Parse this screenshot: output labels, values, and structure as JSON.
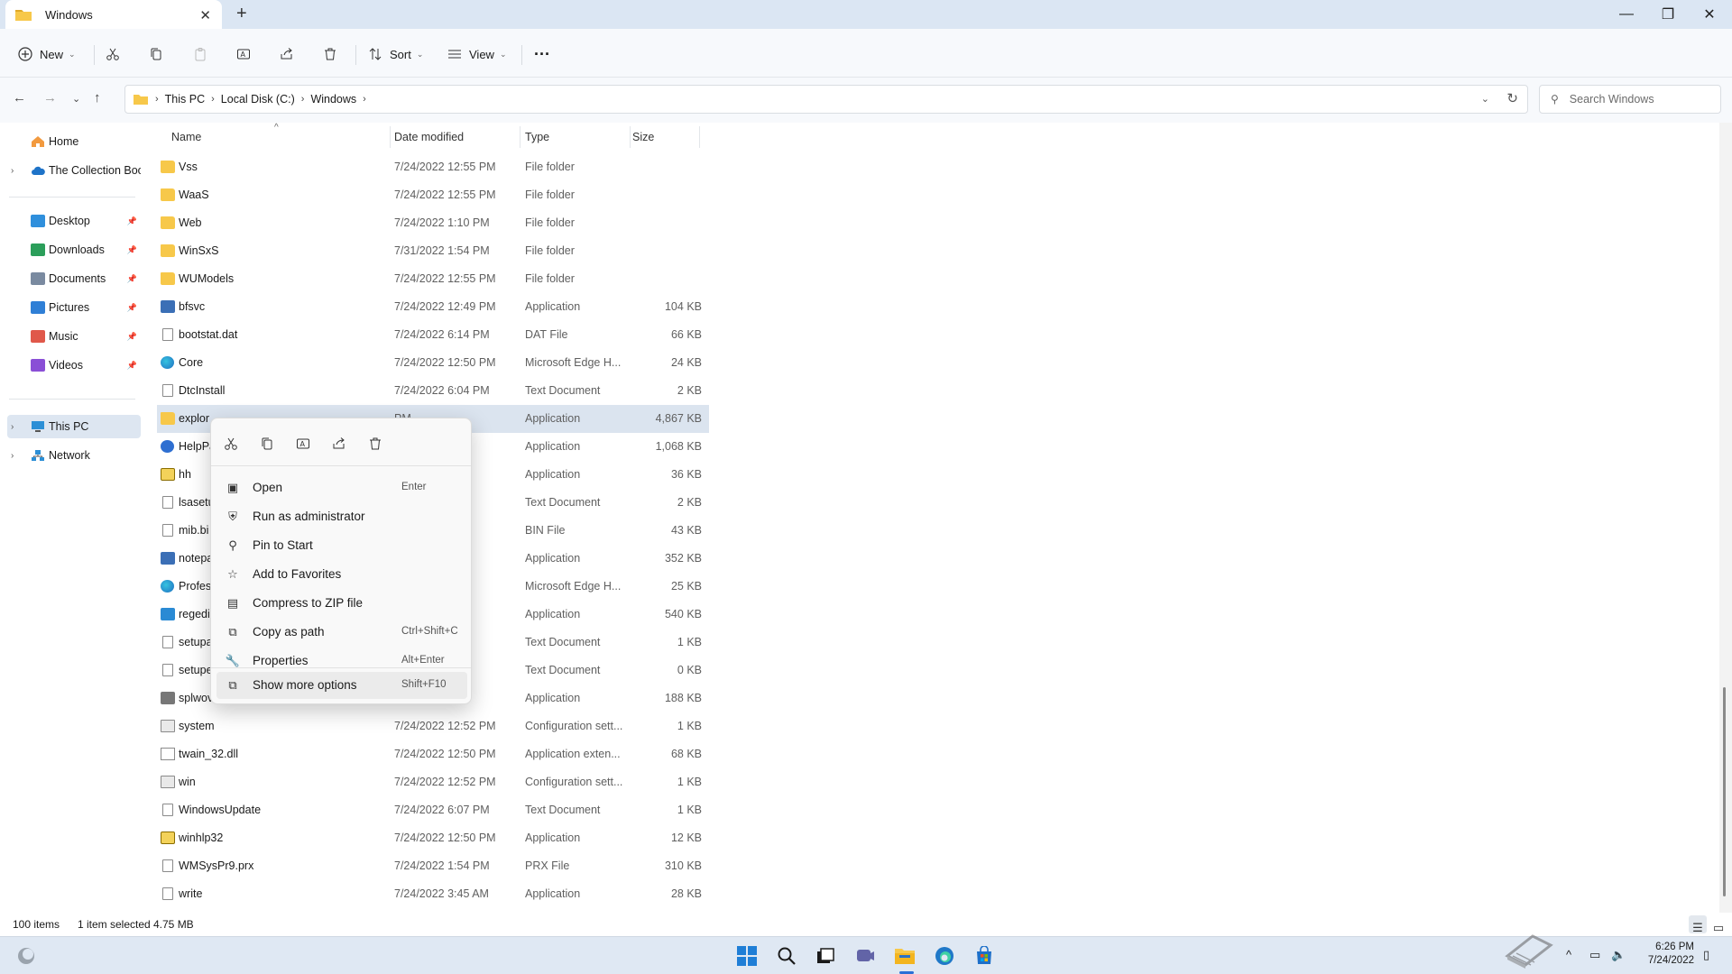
{
  "window": {
    "tab_title": "Windows",
    "new_tab": "+",
    "close_tab": "✕",
    "minimize": "—",
    "maximize": "❐",
    "close": "✕"
  },
  "toolbar": {
    "new_label": "New",
    "sort_label": "Sort",
    "view_label": "View",
    "more": "···",
    "icons": [
      "cut-icon",
      "copy-icon",
      "paste-icon",
      "rename-icon",
      "share-icon",
      "delete-icon"
    ]
  },
  "address": {
    "crumbs": [
      "This PC",
      "Local Disk (C:)",
      "Windows"
    ],
    "search_placeholder": "Search Windows"
  },
  "nav": {
    "top": [
      {
        "label": "Home"
      },
      {
        "label": "The Collection Boo"
      }
    ],
    "quick": [
      {
        "label": "Desktop",
        "color": "#2f8fdc"
      },
      {
        "label": "Downloads",
        "color": "#2b9e5a"
      },
      {
        "label": "Documents",
        "color": "#7a8aa0"
      },
      {
        "label": "Pictures",
        "color": "#2f7fd6"
      },
      {
        "label": "Music",
        "color": "#e0584a"
      },
      {
        "label": "Videos",
        "color": "#8a4fd6"
      }
    ],
    "devices": [
      {
        "label": "This PC"
      },
      {
        "label": "Network"
      }
    ]
  },
  "columns": {
    "name": "Name",
    "date": "Date modified",
    "type": "Type",
    "size": "Size"
  },
  "files": [
    {
      "name": "Vss",
      "date": "7/24/2022 12:55 PM",
      "type": "File folder",
      "size": "",
      "icon": "folder"
    },
    {
      "name": "WaaS",
      "date": "7/24/2022 12:55 PM",
      "type": "File folder",
      "size": "",
      "icon": "folder"
    },
    {
      "name": "Web",
      "date": "7/24/2022 1:10 PM",
      "type": "File folder",
      "size": "",
      "icon": "folder"
    },
    {
      "name": "WinSxS",
      "date": "7/31/2022 1:54 PM",
      "type": "File folder",
      "size": "",
      "icon": "folder"
    },
    {
      "name": "WUModels",
      "date": "7/24/2022 12:55 PM",
      "type": "File folder",
      "size": "",
      "icon": "folder"
    },
    {
      "name": "bfsvc",
      "date": "7/24/2022 12:49 PM",
      "type": "Application",
      "size": "104 KB",
      "icon": "app"
    },
    {
      "name": "bootstat.dat",
      "date": "7/24/2022 6:14 PM",
      "type": "DAT File",
      "size": "66 KB",
      "icon": "doc"
    },
    {
      "name": "Core",
      "date": "7/24/2022 12:50 PM",
      "type": "Microsoft Edge H...",
      "size": "24 KB",
      "icon": "edge"
    },
    {
      "name": "DtcInstall",
      "date": "7/24/2022 6:04 PM",
      "type": "Text Document",
      "size": "2 KB",
      "icon": "doc"
    },
    {
      "name": "explor",
      "date": "PM",
      "type": "Application",
      "size": "4,867 KB",
      "icon": "folder",
      "selected": true
    },
    {
      "name": "HelpPa",
      "date": "PM",
      "type": "Application",
      "size": "1,068 KB",
      "icon": "help"
    },
    {
      "name": "hh",
      "date": "PM",
      "type": "Application",
      "size": "36 KB",
      "icon": "hh"
    },
    {
      "name": "lsasetu",
      "date": "M",
      "type": "Text Document",
      "size": "2 KB",
      "icon": "doc"
    },
    {
      "name": "mib.bi",
      "date": "PM",
      "type": "BIN File",
      "size": "43 KB",
      "icon": "doc"
    },
    {
      "name": "notepa",
      "date": "AM",
      "type": "Application",
      "size": "352 KB",
      "icon": "app"
    },
    {
      "name": "Profes",
      "date": "PM",
      "type": "Microsoft Edge H...",
      "size": "25 KB",
      "icon": "edge"
    },
    {
      "name": "regedi",
      "date": "PM",
      "type": "Application",
      "size": "540 KB",
      "icon": "reg"
    },
    {
      "name": "setupa",
      "date": "M",
      "type": "Text Document",
      "size": "1 KB",
      "icon": "doc"
    },
    {
      "name": "setupe",
      "date": "M",
      "type": "Text Document",
      "size": "0 KB",
      "icon": "doc"
    },
    {
      "name": "splwov",
      "date": "PM",
      "type": "Application",
      "size": "188 KB",
      "icon": "print"
    },
    {
      "name": "system",
      "date": "7/24/2022 12:52 PM",
      "type": "Configuration sett...",
      "size": "1 KB",
      "icon": "cfg"
    },
    {
      "name": "twain_32.dll",
      "date": "7/24/2022 12:50 PM",
      "type": "Application exten...",
      "size": "68 KB",
      "icon": "dll"
    },
    {
      "name": "win",
      "date": "7/24/2022 12:52 PM",
      "type": "Configuration sett...",
      "size": "1 KB",
      "icon": "cfg"
    },
    {
      "name": "WindowsUpdate",
      "date": "7/24/2022 6:07 PM",
      "type": "Text Document",
      "size": "1 KB",
      "icon": "doc"
    },
    {
      "name": "winhlp32",
      "date": "7/24/2022 12:50 PM",
      "type": "Application",
      "size": "12 KB",
      "icon": "hh"
    },
    {
      "name": "WMSysPr9.prx",
      "date": "7/24/2022 1:54 PM",
      "type": "PRX File",
      "size": "310 KB",
      "icon": "doc"
    },
    {
      "name": "write",
      "date": "7/24/2022 3:45 AM",
      "type": "Application",
      "size": "28 KB",
      "icon": "doc"
    }
  ],
  "context_menu": {
    "quick_actions": [
      "cut-icon",
      "copy-icon",
      "rename-icon",
      "share-icon",
      "delete-icon"
    ],
    "items": [
      {
        "label": "Open",
        "shortcut": "Enter",
        "icon": "open-icon",
        "glyph": "▣"
      },
      {
        "label": "Run as administrator",
        "shortcut": "",
        "icon": "shield-icon",
        "glyph": "⛨"
      },
      {
        "label": "Pin to Start",
        "shortcut": "",
        "icon": "pin-icon",
        "glyph": "⚲"
      },
      {
        "label": "Add to Favorites",
        "shortcut": "",
        "icon": "star-icon",
        "glyph": "☆"
      },
      {
        "label": "Compress to ZIP file",
        "shortcut": "",
        "icon": "zip-icon",
        "glyph": "▤"
      },
      {
        "label": "Copy as path",
        "shortcut": "Ctrl+Shift+C",
        "icon": "copy-path-icon",
        "glyph": "⧉"
      },
      {
        "label": "Properties",
        "shortcut": "Alt+Enter",
        "icon": "wrench-icon",
        "glyph": "🔧"
      }
    ],
    "more": {
      "label": "Show more options",
      "shortcut": "Shift+F10",
      "icon": "more-options-icon",
      "glyph": "⧉"
    }
  },
  "status": {
    "count": "100 items",
    "selection": "1 item selected",
    "size": "4.75 MB"
  },
  "taskbar": {
    "time": "6:26 PM",
    "date": "7/24/2022",
    "accent": "#2a6fd6"
  }
}
